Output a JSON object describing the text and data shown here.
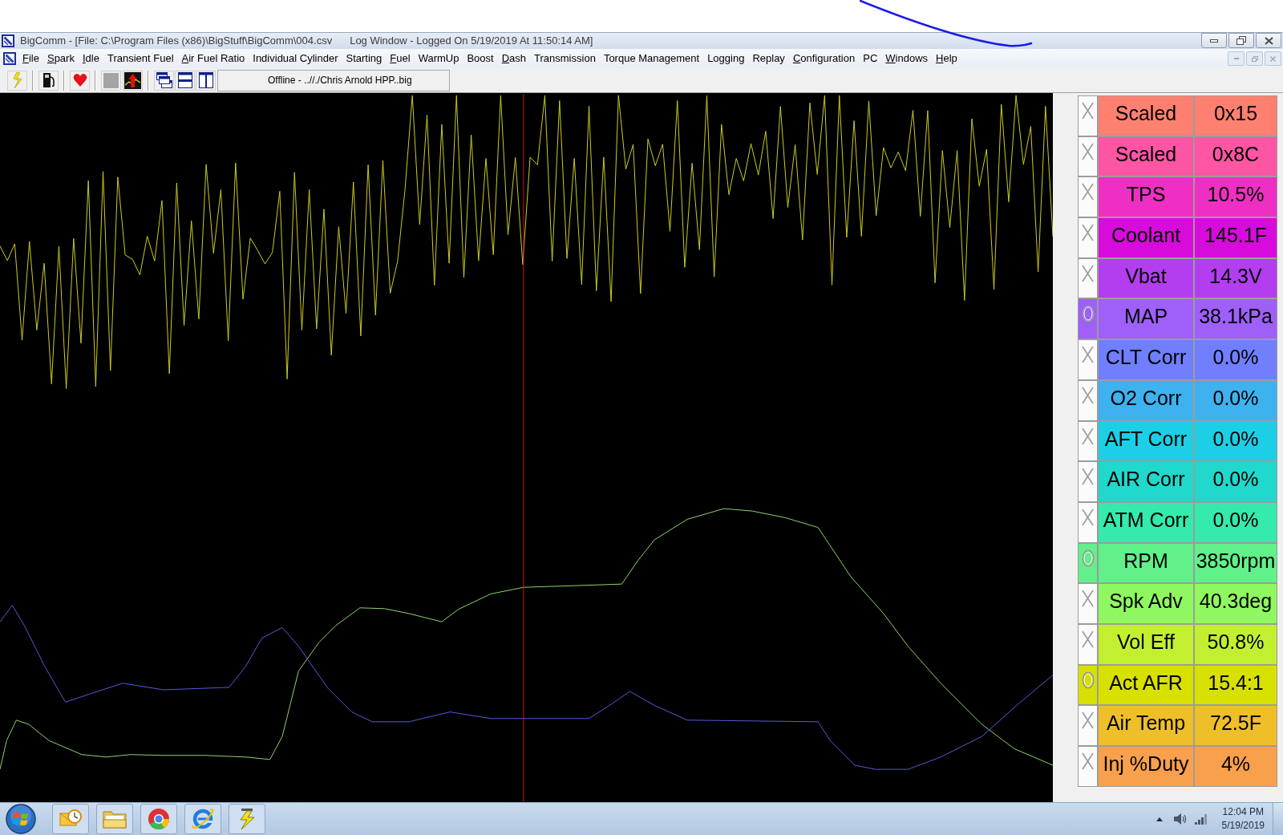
{
  "window": {
    "title": "BigComm - [File: C:\\Program Files (x86)\\BigStuff\\BigComm\\004.csv",
    "document_title": "Log Window - Logged On 5/19/2019 At 11:50:14 AM]"
  },
  "menu": [
    {
      "label": "File",
      "hotkey": true
    },
    {
      "label": "Spark",
      "hotkey": true
    },
    {
      "label": "Idle",
      "hotkey": true
    },
    {
      "label": "Transient Fuel",
      "hotkey": false
    },
    {
      "label": "Air Fuel Ratio",
      "hotkey": true
    },
    {
      "label": "Individual Cylinder",
      "hotkey": false
    },
    {
      "label": "Starting",
      "hotkey": false
    },
    {
      "label": "Fuel",
      "hotkey": true
    },
    {
      "label": "WarmUp",
      "hotkey": false
    },
    {
      "label": "Boost",
      "hotkey": false
    },
    {
      "label": "Dash",
      "hotkey": true
    },
    {
      "label": "Transmission",
      "hotkey": false
    },
    {
      "label": "Torque Management",
      "hotkey": false
    },
    {
      "label": "Logging",
      "hotkey": false
    },
    {
      "label": "Replay",
      "hotkey": false
    },
    {
      "label": "Configuration",
      "hotkey": true
    },
    {
      "label": "PC",
      "hotkey": false
    },
    {
      "label": "Windows",
      "hotkey": true
    },
    {
      "label": "Help",
      "hotkey": true
    }
  ],
  "toolbar": {
    "status": "Offline - ..//./Chris Arnold HPP..big"
  },
  "channels": [
    {
      "name": "Scaled",
      "value": "0x15",
      "color": "#ff8070",
      "plotted": false
    },
    {
      "name": "Scaled",
      "value": "0x8C",
      "color": "#ff55a5",
      "plotted": false
    },
    {
      "name": "TPS",
      "value": "10.5%",
      "color": "#ef2fc3",
      "plotted": false
    },
    {
      "name": "Coolant",
      "value": "145.1F",
      "color": "#d70bdc",
      "plotted": false
    },
    {
      "name": "Vbat",
      "value": "14.3V",
      "color": "#b23ef0",
      "plotted": false
    },
    {
      "name": "MAP",
      "value": "38.1kPa",
      "color": "#9f5ff9",
      "plotted": true
    },
    {
      "name": "CLT Corr",
      "value": "0.0%",
      "color": "#6f7ffd",
      "plotted": false
    },
    {
      "name": "O2 Corr",
      "value": "0.0%",
      "color": "#3db2ef",
      "plotted": false
    },
    {
      "name": "AFT Corr",
      "value": "0.0%",
      "color": "#1ccfe6",
      "plotted": false
    },
    {
      "name": "AIR Corr",
      "value": "0.0%",
      "color": "#20d8cc",
      "plotted": false
    },
    {
      "name": "ATM Corr",
      "value": "0.0%",
      "color": "#34eaad",
      "plotted": false
    },
    {
      "name": "RPM",
      "value": "3850rpm",
      "color": "#61f08a",
      "plotted": true
    },
    {
      "name": "Spk Adv",
      "value": "40.3deg",
      "color": "#8ff860",
      "plotted": false
    },
    {
      "name": "Vol Eff",
      "value": "50.8%",
      "color": "#c2f030",
      "plotted": false
    },
    {
      "name": "Act AFR",
      "value": "15.4:1",
      "color": "#d8e000",
      "plotted": true
    },
    {
      "name": "Air Temp",
      "value": "72.5F",
      "color": "#efbf2a",
      "plotted": false
    },
    {
      "name": "Inj %Duty",
      "value": "4%",
      "color": "#f9a04d",
      "plotted": false
    }
  ],
  "taskbar": {
    "time": "12:04 PM",
    "date": "5/19/2019"
  }
}
